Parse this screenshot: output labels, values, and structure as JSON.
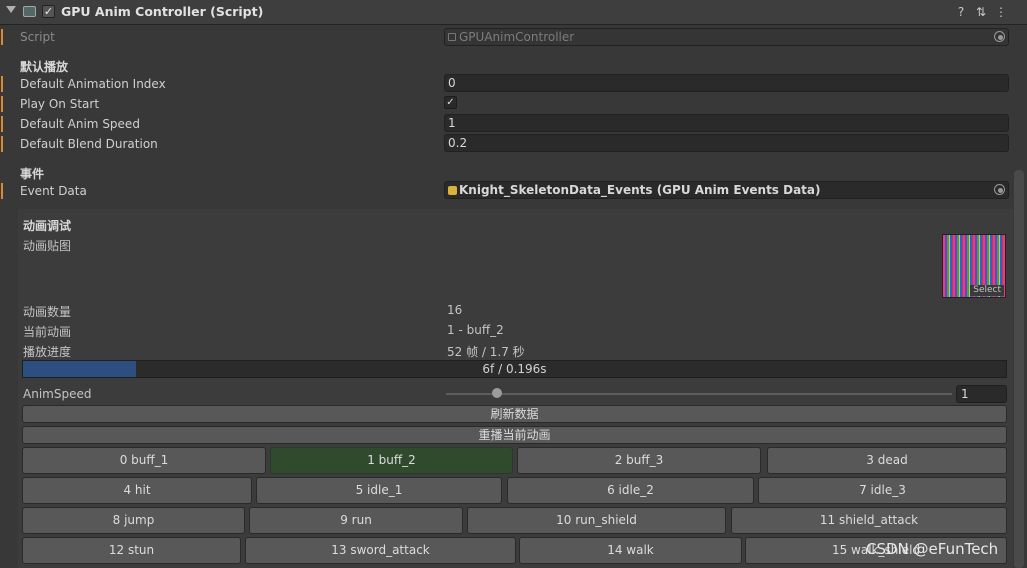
{
  "header": {
    "title": "GPU Anim Controller (Script)",
    "enabled_check": "✓",
    "help_icon": "?",
    "settings_icon": "⇅",
    "menu_icon": "⋮"
  },
  "fields": {
    "script": {
      "label": "Script",
      "value": "GPUAnimController"
    },
    "section_default": "默认播放",
    "default_animation_index": {
      "label": "Default Animation Index",
      "value": "0"
    },
    "play_on_start": {
      "label": "Play On Start",
      "check": "✓"
    },
    "default_anim_speed": {
      "label": "Default Anim Speed",
      "value": "1"
    },
    "default_blend_duration": {
      "label": "Default Blend Duration",
      "value": "0.2"
    },
    "section_events": "事件",
    "event_data": {
      "label": "Event Data",
      "value": "Knight_SkeletonData_Events (GPU Anim Events Data)"
    }
  },
  "debug": {
    "title": "动画调试",
    "texture_label": "动画贴图",
    "texture_select": "Select",
    "anim_count_label": "动画数量",
    "anim_count_value": "16",
    "current_anim_label": "当前动画",
    "current_anim_value": "1 - buff_2",
    "progress_label": "播放进度",
    "progress_value": "52 帧 / 1.7 秒",
    "progress_bar_text": "6f / 0.196s",
    "progress_fraction": 0.115,
    "anim_speed_label": "AnimSpeed",
    "anim_speed_value": "1",
    "anim_speed_slider_fraction": 0.1,
    "refresh_button": "刷新数据",
    "replay_button": "重播当前动画",
    "anim_buttons": [
      [
        "0 buff_1",
        "1 buff_2",
        "2 buff_3",
        "3 dead"
      ],
      [
        "4 hit",
        "5 idle_1",
        "6 idle_2",
        "7 idle_3"
      ],
      [
        "8 jump",
        "9 run",
        "10 run_shield",
        "11 shield_attack"
      ],
      [
        "12 stun",
        "13 sword_attack",
        "14 walk",
        "15 walk_shield"
      ]
    ],
    "active_button": "1 buff_2"
  },
  "watermark": "CSDN @eFunTech",
  "colors": {
    "accent_orange": "#d98a35",
    "progress_fill": "#2c4f80",
    "active_button": "#2f4a2d"
  }
}
